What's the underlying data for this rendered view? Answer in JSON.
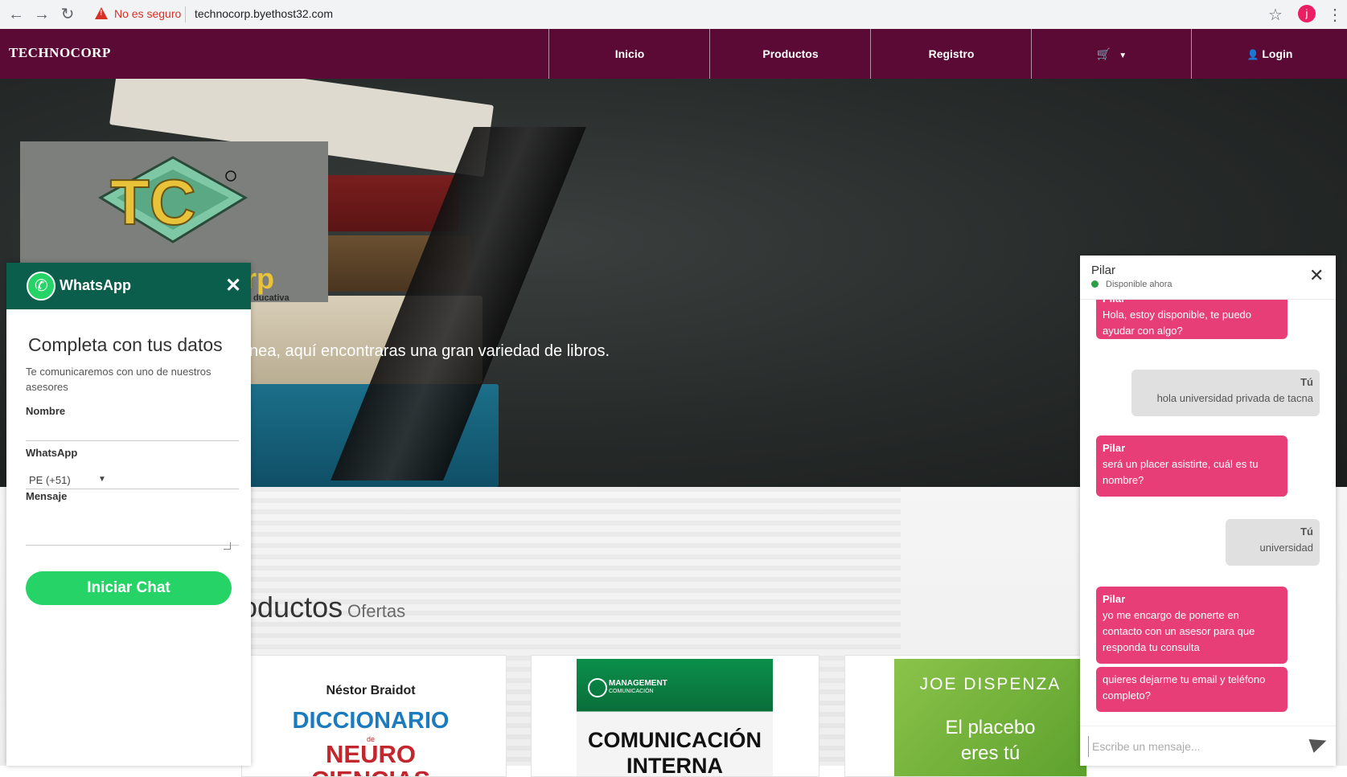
{
  "browser": {
    "insecure_label": "No es seguro",
    "url": "technocorp.byethost32.com",
    "profile_initial": "j"
  },
  "navbar": {
    "brand": "TECHNOCORP",
    "items": [
      "Inicio",
      "Productos",
      "Registro"
    ],
    "cart_icon": "cart-icon",
    "login_label": "Login"
  },
  "hero": {
    "logo_letters": "TC",
    "logo_word": "orp",
    "logo_tagline": "ducativa",
    "text": "nea, aquí encontraras una gran variedad de libros."
  },
  "products": {
    "title": "oductos",
    "subtitle": "Ofertas",
    "books": [
      {
        "author": "Néstor Braidot",
        "title_1": "DICCIONARIO",
        "title_2": "de",
        "title_3": "NEURO",
        "title_4": "CIENCIAS"
      },
      {
        "series_1": "MANAGEMENT",
        "series_2": "COMUNICACIÓN",
        "title_1": "COMUNICACIÓN",
        "title_2": "INTERNA"
      },
      {
        "author": "JOE DISPENZA",
        "title_1": "El placebo",
        "title_2": "eres tú"
      }
    ]
  },
  "whatsapp": {
    "title": "WhatsApp",
    "heading": "Completa con tus datos",
    "description": "Te comunicaremos con uno de nuestros asesores",
    "name_label": "Nombre",
    "whatsapp_label": "WhatsApp",
    "country_value": "PE (+51)",
    "message_label": "Mensaje",
    "button_label": "Iniciar Chat"
  },
  "chat": {
    "agent_name": "Pilar",
    "status": "Disponible ahora",
    "messages": [
      {
        "from": "Pilar",
        "text": "Hola, estoy disponible, te puedo ayudar con algo?"
      },
      {
        "from": "Tú",
        "text": "hola universidad privada de tacna"
      },
      {
        "from": "Pilar",
        "text": "será un placer asistirte, cuál es tu nombre?"
      },
      {
        "from": "Tú",
        "text": "universidad"
      },
      {
        "from": "Pilar",
        "text": "yo me encargo de ponerte en contacto con un asesor para que responda tu consulta"
      },
      {
        "from": "",
        "text": "quieres dejarme tu email y teléfono completo?"
      }
    ],
    "input_placeholder": "Escribe un mensaje..."
  },
  "colors": {
    "navbar": "#5a0a35",
    "whatsapp_header": "#0a5e4b",
    "whatsapp_button": "#25d366",
    "chat_agent_bubble": "#e83e78"
  }
}
